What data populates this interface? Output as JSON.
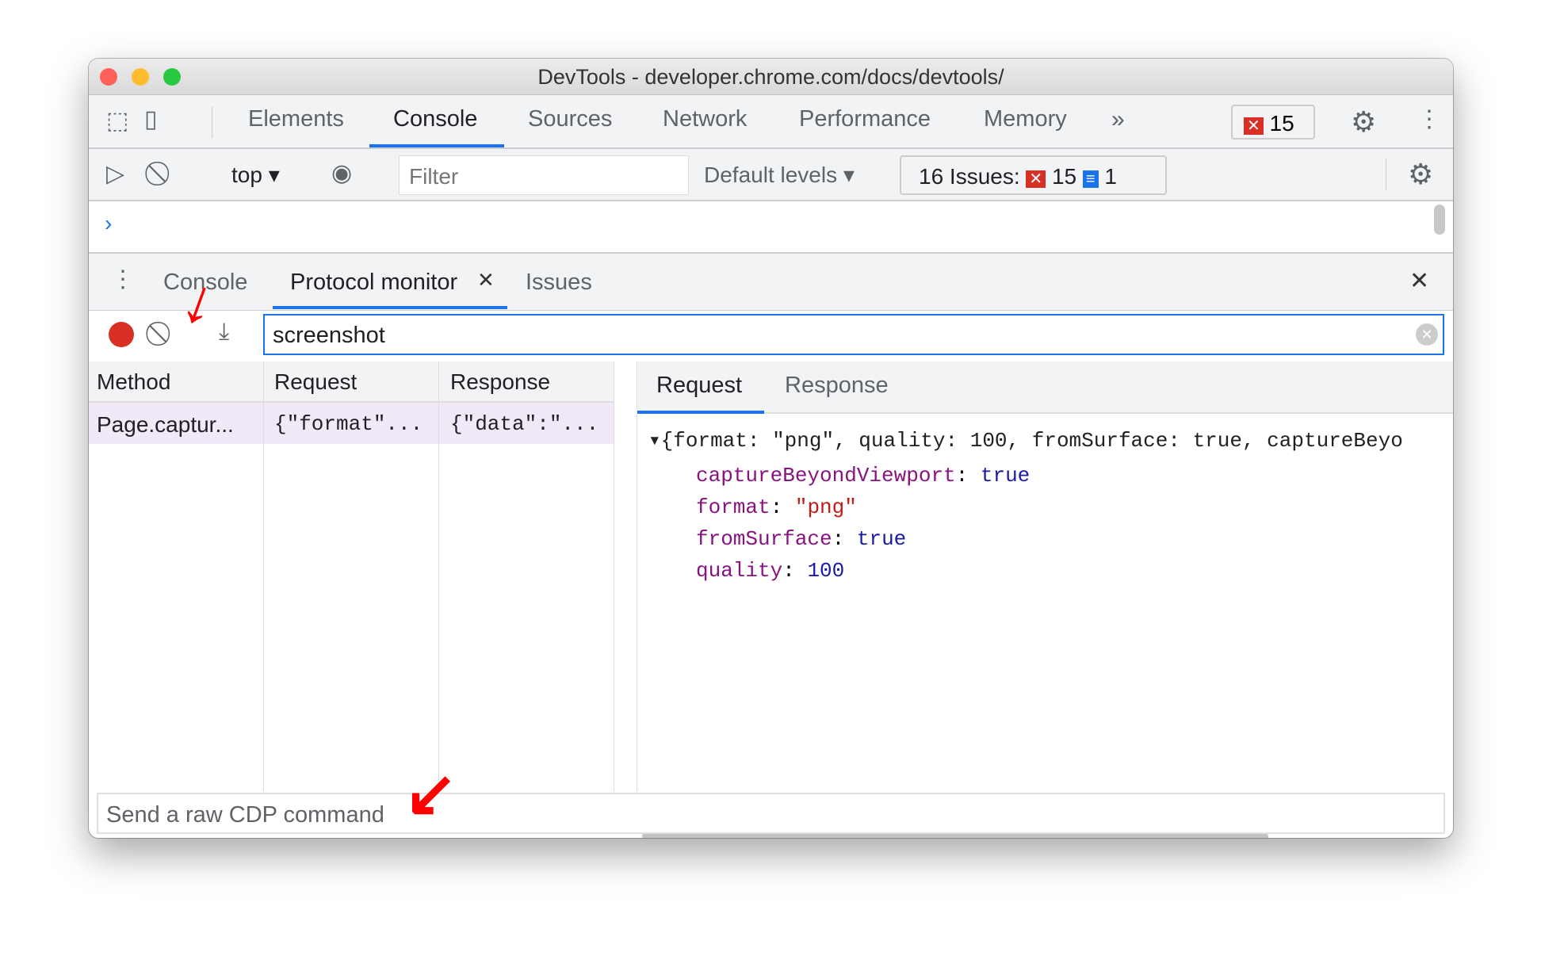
{
  "window": {
    "title": "DevTools - developer.chrome.com/docs/devtools/"
  },
  "main_tabs": [
    {
      "label": "Elements"
    },
    {
      "label": "Console"
    },
    {
      "label": "Sources"
    },
    {
      "label": "Network"
    },
    {
      "label": "Performance"
    },
    {
      "label": "Memory"
    }
  ],
  "active_main_tab": "Console",
  "error_badge": {
    "count": "15"
  },
  "console_toolbar": {
    "context": "top",
    "filter_placeholder": "Filter",
    "levels": "Default levels",
    "issues_label": "16 Issues:",
    "issues_errors": "15",
    "issues_info": "1"
  },
  "drawer_tabs": [
    {
      "label": "Console"
    },
    {
      "label": "Protocol monitor"
    },
    {
      "label": "Issues"
    }
  ],
  "protocol": {
    "filter_value": "screenshot",
    "columns": [
      "Method",
      "Request",
      "Response"
    ],
    "rows": [
      {
        "method": "Page.captur...",
        "request": "{\"format\"...",
        "response": "{\"data\":\"..."
      }
    ],
    "detail_tabs": [
      "Request",
      "Response"
    ],
    "summary": "{format: \"png\", quality: 100, fromSurface: true, captureBeyo",
    "props": [
      {
        "key": "captureBeyondViewport",
        "value": "true",
        "type": "bool"
      },
      {
        "key": "format",
        "value": "\"png\"",
        "type": "str"
      },
      {
        "key": "fromSurface",
        "value": "true",
        "type": "bool"
      },
      {
        "key": "quality",
        "value": "100",
        "type": "bool"
      }
    ],
    "command_placeholder": "Send a raw CDP command"
  },
  "colors": {
    "accent": "#1a73e8",
    "record": "#d93025",
    "annotation": "#ff0000"
  }
}
